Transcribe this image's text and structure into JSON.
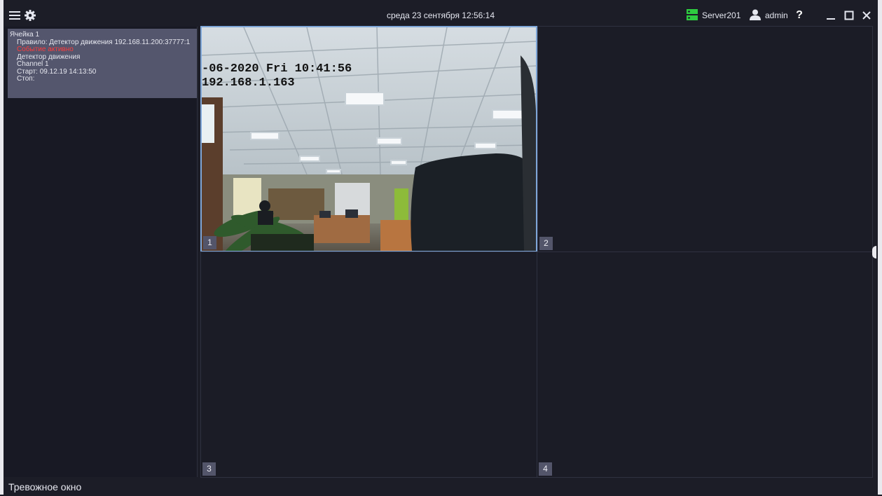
{
  "titlebar": {
    "clock": "среда 23 сентября 12:56:14",
    "server_name": "Server201",
    "user_name": "admin",
    "help_label": "?"
  },
  "event": {
    "cell": "Ячейка 1",
    "rule": "Правило: Детектор движения 192.168.11.200:37777:1",
    "status": "Событие активно",
    "detector": "Детектор движения",
    "channel": "Channel 1",
    "start": "Старт: 09.12.19 14:13:50",
    "stop": "Стоп:"
  },
  "cells": [
    {
      "number": "1"
    },
    {
      "number": "2"
    },
    {
      "number": "3"
    },
    {
      "number": "4"
    }
  ],
  "camera": {
    "osd_datetime": "-06-2020 Fri 10:41:56",
    "osd_ip": "192.168.1.163"
  },
  "status_bar": {
    "label": "Тревожное окно"
  },
  "colors": {
    "accent_selected": "#7ea6d8",
    "server_icon": "#2ecc40",
    "alert_text": "#ff3b3b"
  }
}
